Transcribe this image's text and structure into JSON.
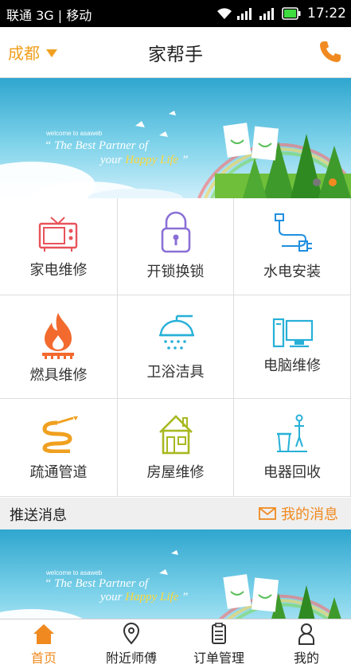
{
  "status_bar": {
    "carrier": "联通 3G | 移动",
    "time": "17:22"
  },
  "header": {
    "city": "成都",
    "title": "家帮手"
  },
  "banner": {
    "welcome": "welcome to asaweb",
    "line1": "“ The Best Partner of",
    "line2_prefix": "your ",
    "line2_highlight": "Happy Life",
    "line2_suffix": " ”",
    "slide_count": 2,
    "active_slide": 2
  },
  "services": [
    {
      "label": "家电维修",
      "icon": "tv-icon"
    },
    {
      "label": "开锁换锁",
      "icon": "padlock-icon"
    },
    {
      "label": "水电安装",
      "icon": "plug-icon"
    },
    {
      "label": "燃具维修",
      "icon": "gas-flame-icon"
    },
    {
      "label": "卫浴洁具",
      "icon": "shower-icon"
    },
    {
      "label": "电脑维修",
      "icon": "computer-icon"
    },
    {
      "label": "疏通管道",
      "icon": "pipe-icon"
    },
    {
      "label": "房屋维修",
      "icon": "house-icon"
    },
    {
      "label": "电器回收",
      "icon": "recycle-bin-icon"
    }
  ],
  "push_section": {
    "title": "推送消息",
    "my_messages": "我的消息"
  },
  "tabs": [
    {
      "label": "首页",
      "icon": "home-icon",
      "active": true
    },
    {
      "label": "附近师傅",
      "icon": "location-pin-icon",
      "active": false
    },
    {
      "label": "订单管理",
      "icon": "clipboard-icon",
      "active": false
    },
    {
      "label": "我的",
      "icon": "person-icon",
      "active": false
    }
  ],
  "colors": {
    "accent": "#f08a20",
    "city": "#f0a020",
    "sky": "#4fb6d8"
  }
}
